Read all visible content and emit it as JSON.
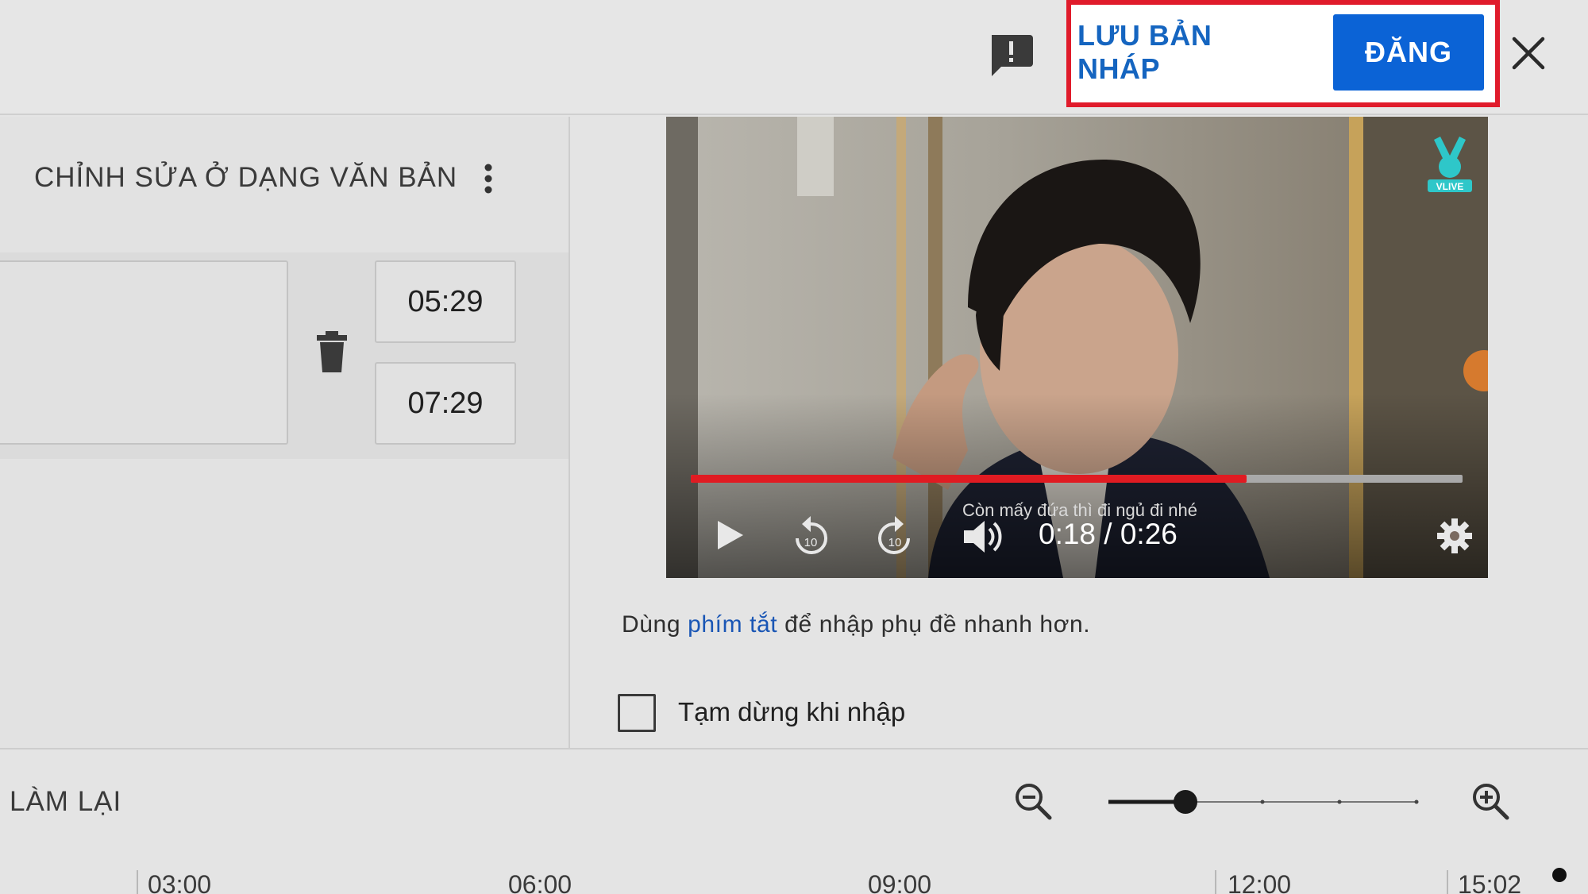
{
  "header": {
    "feedback_icon": "feedback-exclamation-icon",
    "save_draft_label": "LƯU BẢN NHÁP",
    "publish_label": "ĐĂNG",
    "close_icon": "close-icon"
  },
  "editor": {
    "title": "CHỈNH SỬA Ở DẠNG VĂN BẢN",
    "more_icon": "more-vert-icon",
    "caption": {
      "text": "",
      "start_time": "05:29",
      "end_time": "07:29",
      "delete_icon": "trash-icon"
    }
  },
  "player": {
    "progress": 0.72,
    "subtitle": "Còn mấy đứa thì đi ngủ đi nhé",
    "time": "0:18 / 0:26",
    "controls": [
      "play-icon",
      "rewind-10-icon",
      "forward-10-icon",
      "volume-icon",
      "settings-icon"
    ],
    "logo": "vlive-logo"
  },
  "hint": {
    "before": "Dùng ",
    "link": "phím tắt",
    "after": " để nhập phụ đề nhanh hơn."
  },
  "pause_option": {
    "label": "Tạm dừng khi nhập",
    "checked": false
  },
  "toolbar": {
    "redo_label": "LÀM LẠI",
    "zoom_out_icon": "zoom-out-icon",
    "zoom_in_icon": "zoom-in-icon",
    "zoom_level": 0.25
  },
  "timeline": {
    "ticks": [
      "03:00",
      "06:00",
      "09:00",
      "12:00",
      "15:02"
    ]
  },
  "colors": {
    "accent": "#0b63d6",
    "highlight": "#e01b2b",
    "progress": "#e01b22",
    "link": "#1a56b5"
  }
}
